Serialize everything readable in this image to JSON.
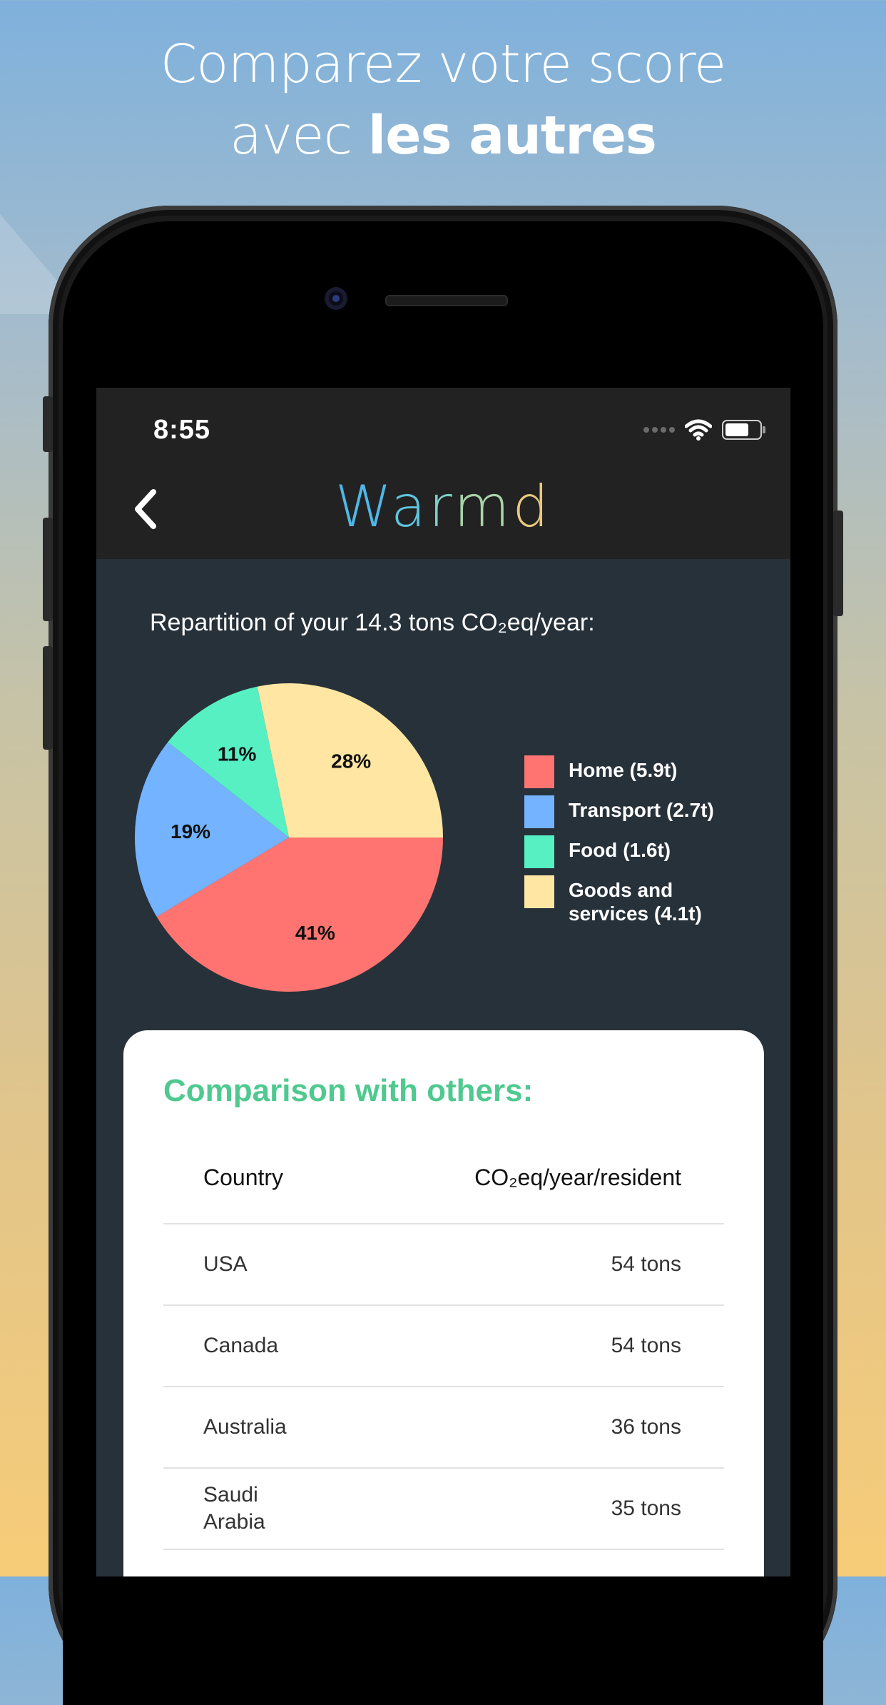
{
  "promo": {
    "line1": "Comparez votre score",
    "line2_prefix": "avec ",
    "line2_bold": "les autres"
  },
  "status": {
    "time": "8:55"
  },
  "app": {
    "title_letters": [
      "W",
      "a",
      "r",
      "m",
      "d"
    ]
  },
  "summary": {
    "subtitle": "Repartition of your 14.3 tons CO₂eq/year:"
  },
  "colors": {
    "home": "#ff7470",
    "transport": "#74b3ff",
    "food": "#56f0c2",
    "goods": "#ffe6a3",
    "accent_green": "#4fc98f"
  },
  "chart_data": {
    "type": "pie",
    "title": "Repartition of your 14.3 tons CO₂eq/year:",
    "series": [
      {
        "name": "Home (5.9t)",
        "value": 41,
        "label": "41%",
        "color": "#ff7470"
      },
      {
        "name": "Transport (2.7t)",
        "value": 19,
        "label": "19%",
        "color": "#74b3ff"
      },
      {
        "name": "Food (1.6t)",
        "value": 11,
        "label": "11%",
        "color": "#56f0c2"
      },
      {
        "name": "Goods and\nservices (4.1t)",
        "value": 28,
        "label": "28%",
        "color": "#ffe6a3"
      }
    ],
    "legend_position": "right"
  },
  "comparison": {
    "title": "Comparison with others:",
    "headers": [
      "Country",
      "CO₂eq/year/resident"
    ],
    "rows": [
      {
        "country": "USA",
        "value": "54 tons"
      },
      {
        "country": "Canada",
        "value": "54 tons"
      },
      {
        "country": "Australia",
        "value": "36 tons"
      },
      {
        "country": "Saudi\nArabia",
        "value": "35 tons"
      }
    ]
  }
}
